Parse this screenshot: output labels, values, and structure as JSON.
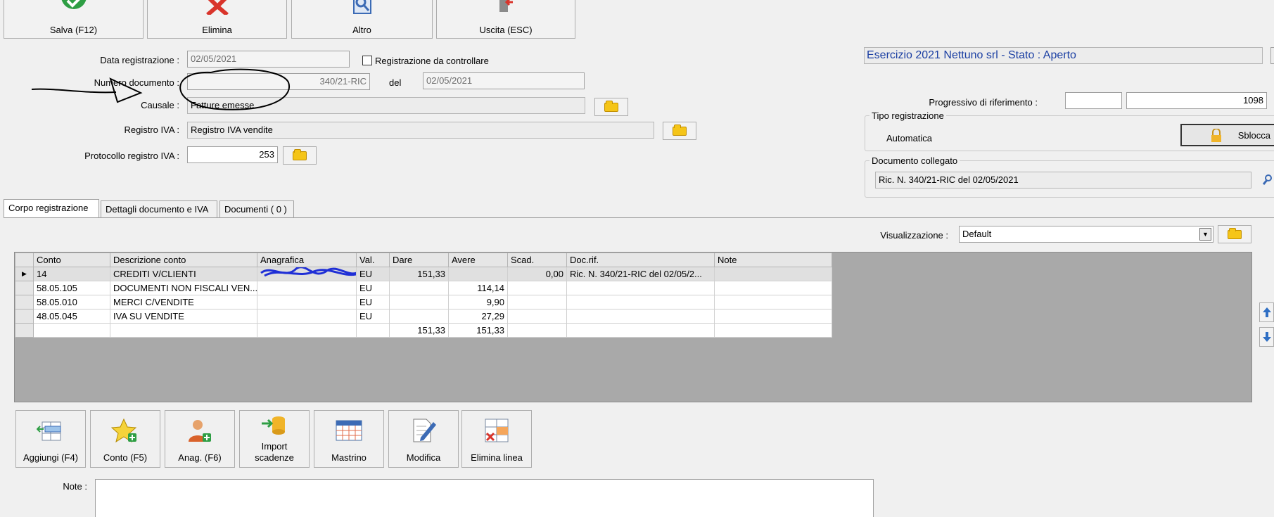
{
  "toolbar": [
    {
      "label": "Salva (F12)"
    },
    {
      "label": "Elimina"
    },
    {
      "label": "Altro"
    },
    {
      "label": "Uscita (ESC)"
    }
  ],
  "form": {
    "data_registrazione_label": "Data registrazione :",
    "data_registrazione_value": "02/05/2021",
    "registrazione_da_controllare_label": "Registrazione da controllare",
    "numero_documento_label": "Numero documento :",
    "numero_documento_value": "340/21-RIC",
    "del_label": "del",
    "del_value": "02/05/2021",
    "causale_label": "Causale :",
    "causale_value": "Fatture emesse",
    "registro_iva_label": "Registro IVA :",
    "registro_iva_value": "Registro IVA vendite",
    "protocollo_label": "Protocollo registro IVA :",
    "protocollo_value": "253"
  },
  "right": {
    "esercizio": "Esercizio 2021 Nettuno srl - Stato : Aperto",
    "progressivo_label": "Progressivo di riferimento :",
    "progressivo_value": "1098",
    "tipo_registrazione_legend": "Tipo registrazione",
    "tipo_registrazione_value": "Automatica",
    "sblocca_label": "Sblocca",
    "documento_collegato_legend": "Documento collegato",
    "documento_collegato_value": "Ric. N. 340/21-RIC del 02/05/2021"
  },
  "tabs": [
    {
      "label": "Corpo registrazione"
    },
    {
      "label": "Dettagli documento e IVA"
    },
    {
      "label": "Documenti ( 0 )"
    }
  ],
  "visualizzazione": {
    "label": "Visualizzazione :",
    "value": "Default"
  },
  "grid": {
    "columns": [
      "Conto",
      "Descrizione conto",
      "Anagrafica",
      "Val.",
      "Dare",
      "Avere",
      "Scad.",
      "Doc.rif.",
      "Note"
    ],
    "rows": [
      {
        "conto": "14",
        "descrizione": "CREDITI V/CLIENTI",
        "anagrafica": "",
        "val": "EU",
        "dare": "151,33",
        "avere": "",
        "scad": "0,00",
        "docrif": "Ric. N. 340/21-RIC del 02/05/2...",
        "note": ""
      },
      {
        "conto": "58.05.105",
        "descrizione": "DOCUMENTI NON FISCALI VEN...",
        "anagrafica": "",
        "val": "EU",
        "dare": "",
        "avere": "114,14",
        "scad": "",
        "docrif": "",
        "note": ""
      },
      {
        "conto": "58.05.010",
        "descrizione": "MERCI C/VENDITE",
        "anagrafica": "",
        "val": "EU",
        "dare": "",
        "avere": "9,90",
        "scad": "",
        "docrif": "",
        "note": ""
      },
      {
        "conto": "48.05.045",
        "descrizione": "IVA SU VENDITE",
        "anagrafica": "",
        "val": "EU",
        "dare": "",
        "avere": "27,29",
        "scad": "",
        "docrif": "",
        "note": ""
      }
    ],
    "totals": {
      "dare": "151,33",
      "avere": "151,33"
    }
  },
  "bottom_buttons": [
    {
      "label": "Aggiungi (F4)"
    },
    {
      "label": "Conto (F5)"
    },
    {
      "label": "Anag. (F6)"
    },
    {
      "label": "Import scadenze"
    },
    {
      "label": "Mastrino"
    },
    {
      "label": "Modifica"
    },
    {
      "label": "Elimina linea"
    }
  ],
  "note_label": "Note :"
}
